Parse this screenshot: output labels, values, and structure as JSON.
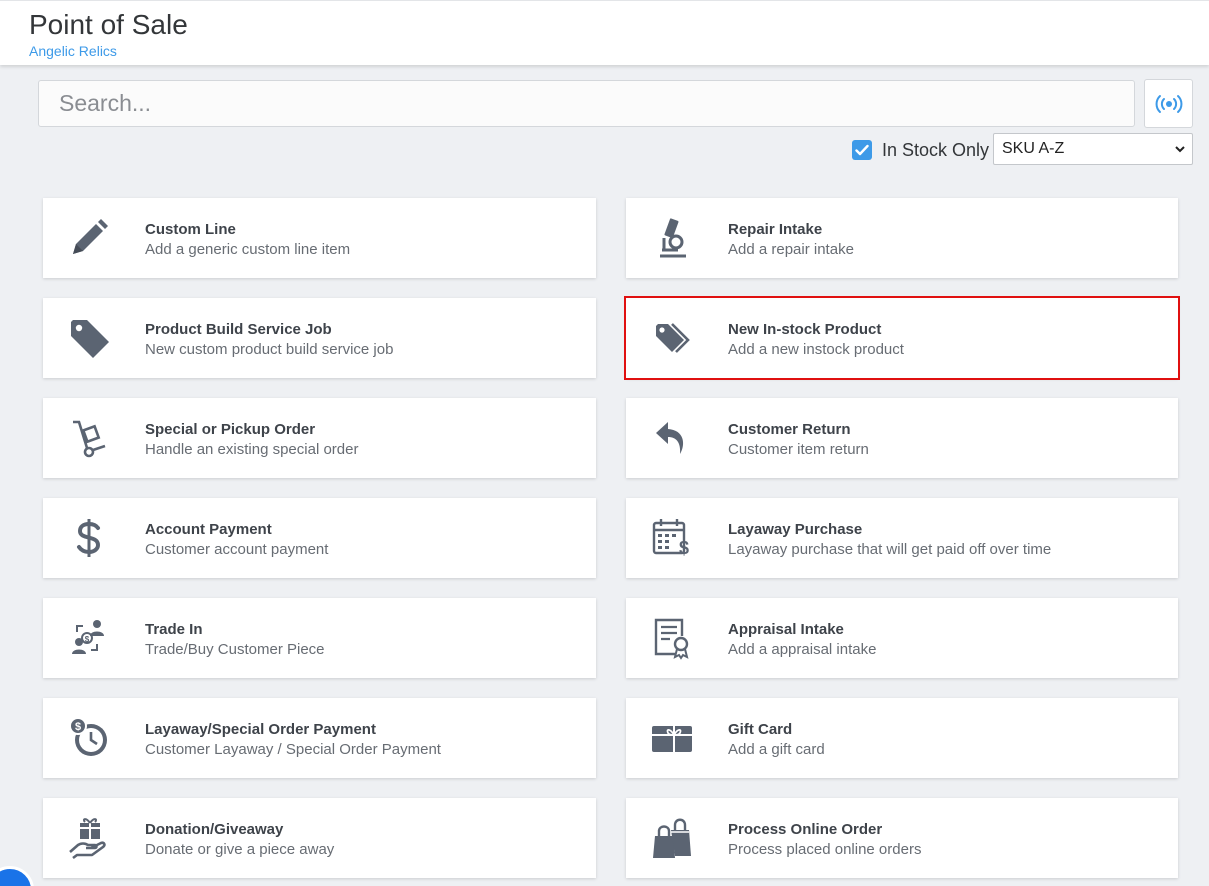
{
  "header": {
    "title": "Point of Sale",
    "store": "Angelic Relics"
  },
  "search": {
    "placeholder": "Search..."
  },
  "filters": {
    "in_stock_label": "In Stock Only",
    "in_stock_checked": true,
    "sort_selected": "SKU A-Z"
  },
  "colors": {
    "accent": "#3d9ae8",
    "icon": "#5b6472",
    "highlight": "#e01010"
  },
  "cards": [
    {
      "title": "Custom Line",
      "desc": "Add a generic custom line item",
      "icon": "pencil-icon"
    },
    {
      "title": "Repair Intake",
      "desc": "Add a repair intake",
      "icon": "microscope-icon"
    },
    {
      "title": "Product Build Service Job",
      "desc": "New custom product build service job",
      "icon": "tag-icon"
    },
    {
      "title": "New In-stock Product",
      "desc": "Add a new instock product",
      "icon": "tags-icon",
      "highlighted": true
    },
    {
      "title": "Special or Pickup Order",
      "desc": "Handle an existing special order",
      "icon": "hand-truck-icon"
    },
    {
      "title": "Customer Return",
      "desc": "Customer item return",
      "icon": "return-arrow-icon"
    },
    {
      "title": "Account Payment",
      "desc": "Customer account payment",
      "icon": "dollar-icon"
    },
    {
      "title": "Layaway Purchase",
      "desc": "Layaway purchase that will get paid off over time",
      "icon": "calendar-dollar-icon"
    },
    {
      "title": "Trade In",
      "desc": "Trade/Buy Customer Piece",
      "icon": "trade-exchange-icon"
    },
    {
      "title": "Appraisal Intake",
      "desc": "Add a appraisal intake",
      "icon": "certificate-icon"
    },
    {
      "title": "Layaway/Special Order Payment",
      "desc": "Customer Layaway / Special Order Payment",
      "icon": "clock-dollar-icon"
    },
    {
      "title": "Gift Card",
      "desc": "Add a gift card",
      "icon": "gift-card-icon"
    },
    {
      "title": "Donation/Giveaway",
      "desc": "Donate or give a piece away",
      "icon": "hand-gift-icon"
    },
    {
      "title": "Process Online Order",
      "desc": "Process placed online orders",
      "icon": "shopping-bag-icon"
    }
  ]
}
